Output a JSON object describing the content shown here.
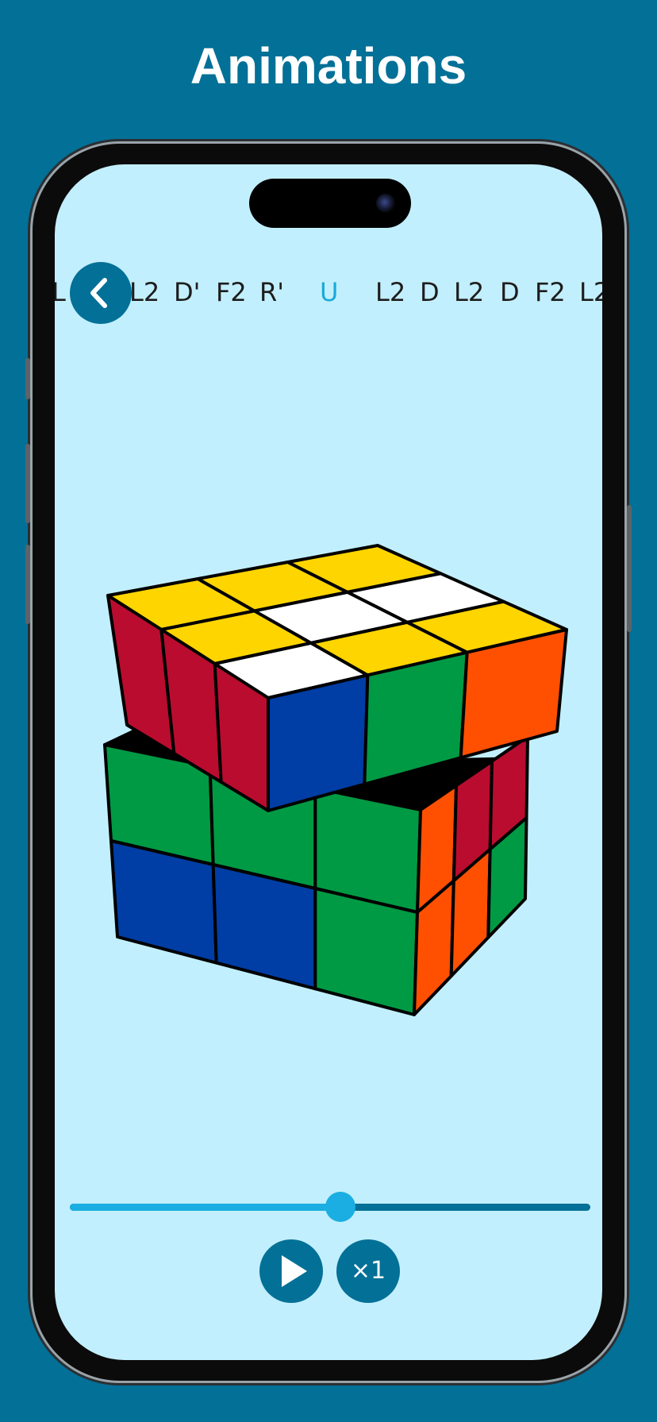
{
  "headline": "Animations",
  "moves": {
    "items": [
      "L",
      "L2",
      "D'",
      "F2",
      "R'",
      "U",
      "L2",
      "D",
      "L2",
      "D",
      "F2",
      "L2"
    ],
    "current_index": 5
  },
  "playback": {
    "progress": 0.52,
    "speed_label": "×1"
  },
  "icons": {
    "back": "chevron-left-icon",
    "play": "play-icon"
  },
  "colors": {
    "background": "#037097",
    "screen": "#c2effd",
    "accent": "#1aaee2",
    "cube_yellow": "#ffd500",
    "cube_white": "#ffffff",
    "cube_red": "#ba0c2f",
    "cube_blue": "#003da5",
    "cube_green": "#009a44",
    "cube_orange": "#fe5000"
  }
}
